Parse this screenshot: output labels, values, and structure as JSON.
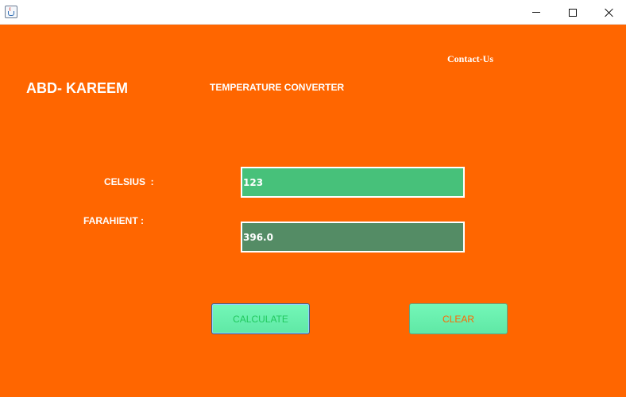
{
  "window": {
    "icon": "java-cup-icon",
    "controls": [
      "minimize-icon",
      "maximize-icon",
      "close-icon"
    ]
  },
  "header": {
    "contact_link": "Contact-Us",
    "brand": "ABD- KAREEM",
    "title": "TEMPERATURE CONVERTER"
  },
  "form": {
    "celsius_label": "CELSIUS  :",
    "celsius_value": "123",
    "fahrenheit_label": "FARAHIENT :",
    "fahrenheit_value": "396.0"
  },
  "buttons": {
    "calculate": "CALCULATE",
    "clear": "CLEAR"
  },
  "colors": {
    "background": "#ff6600",
    "celsius_field": "#47c17a",
    "fahrenheit_field": "#548c65",
    "button": "#6ff0b0"
  }
}
